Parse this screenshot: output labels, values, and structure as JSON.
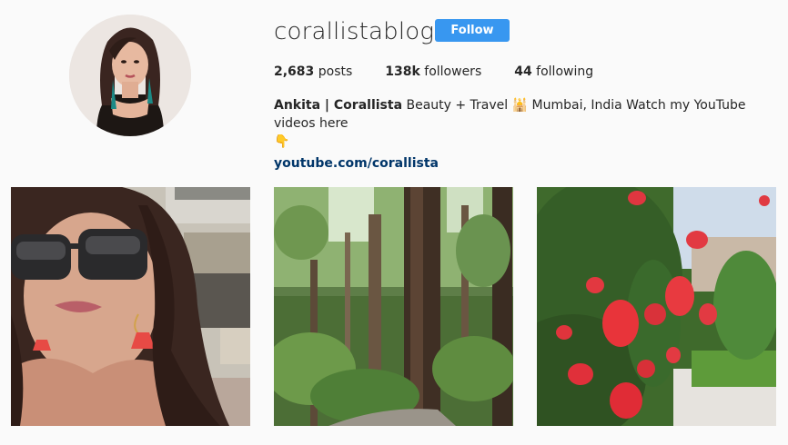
{
  "profile": {
    "username": "corallistablog",
    "follow_label": "Follow",
    "stats": {
      "posts_count": "2,683",
      "posts_label": "posts",
      "followers_count": "138k",
      "followers_label": "followers",
      "following_count": "44",
      "following_label": "following"
    },
    "bio": {
      "name": "Ankita | Corallista",
      "text": "Beauty + Travel 🕌 Mumbai, India Watch my YouTube videos here",
      "emoji_line": "👇",
      "link": "youtube.com/corallista"
    }
  },
  "posts": [
    {
      "subject": "selfie-with-sunglasses"
    },
    {
      "subject": "redwood-forest"
    },
    {
      "subject": "red-bottlebrush-flowers"
    }
  ],
  "colors": {
    "accent": "#3897f0",
    "link": "#003569",
    "background": "#fafafa"
  }
}
